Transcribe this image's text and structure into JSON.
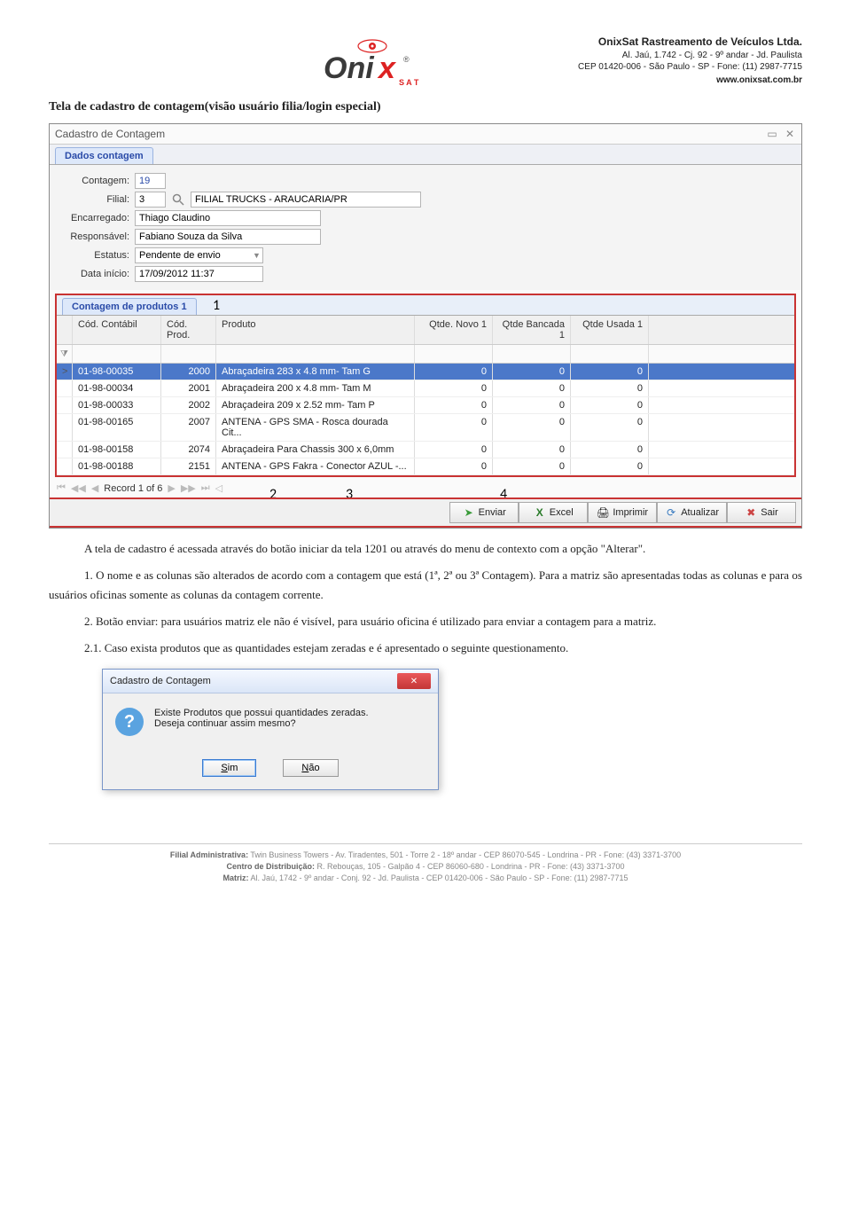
{
  "header": {
    "logo_text": "Onix",
    "logo_sub": "SAT",
    "reg": "®",
    "company_name": "OnixSat Rastreamento de Veículos Ltda.",
    "addr1": "Al. Jaú, 1.742 - Cj. 92 - 9º andar - Jd. Paulista",
    "addr2": "CEP 01420-006 - São Paulo - SP - Fone: (11) 2987-7715",
    "url": "www.onixsat.com.br"
  },
  "section_title": "Tela de cadastro de contagem(visão usuário filia/login especial)",
  "window": {
    "title": "Cadastro de Contagem",
    "tab": "Dados contagem",
    "form": {
      "contagem_label": "Contagem:",
      "contagem_value": "19",
      "filial_label": "Filial:",
      "filial_id": "3",
      "filial_name": "FILIAL TRUCKS - ARAUCARIA/PR",
      "encarregado_label": "Encarregado:",
      "encarregado_value": "Thiago Claudino",
      "responsavel_label": "Responsável:",
      "responsavel_value": "Fabiano Souza da Silva",
      "estatus_label": "Estatus:",
      "estatus_value": "Pendente de envio",
      "data_label": "Data início:",
      "data_value": "17/09/2012 11:37"
    },
    "grid": {
      "tab": "Contagem de produtos 1",
      "callout1": "1",
      "headers": {
        "cod_contabil": "Cód. Contábil",
        "cod_prod": "Cód. Prod.",
        "produto": "Produto",
        "qtde_novo": "Qtde. Novo 1",
        "qtde_bancada": "Qtde Bancada 1",
        "qtde_usada": "Qtde Usada 1"
      },
      "rows": [
        {
          "sel": ">",
          "cod": "01-98-00035",
          "prd": "2000",
          "desc": "Abraçadeira 283 x 4.8 mm- Tam G",
          "q1": "0",
          "q2": "0",
          "q3": "0",
          "selected": true
        },
        {
          "sel": "",
          "cod": "01-98-00034",
          "prd": "2001",
          "desc": "Abraçadeira 200 x 4.8 mm- Tam M",
          "q1": "0",
          "q2": "0",
          "q3": "0"
        },
        {
          "sel": "",
          "cod": "01-98-00033",
          "prd": "2002",
          "desc": "Abraçadeira 209 x 2.52 mm- Tam P",
          "q1": "0",
          "q2": "0",
          "q3": "0"
        },
        {
          "sel": "",
          "cod": "01-98-00165",
          "prd": "2007",
          "desc": "ANTENA - GPS SMA - Rosca dourada Cit...",
          "q1": "0",
          "q2": "0",
          "q3": "0"
        },
        {
          "sel": "",
          "cod": "01-98-00158",
          "prd": "2074",
          "desc": "Abraçadeira Para Chassis 300 x 6,0mm",
          "q1": "0",
          "q2": "0",
          "q3": "0"
        },
        {
          "sel": "",
          "cod": "01-98-00188",
          "prd": "2151",
          "desc": "ANTENA - GPS Fakra - Conector AZUL -...",
          "q1": "0",
          "q2": "0",
          "q3": "0"
        }
      ]
    },
    "pager": "Record 1 of 6",
    "toolbar": {
      "callout2": "2",
      "callout3": "3",
      "callout4": "4",
      "enviar": "Enviar",
      "excel": "Excel",
      "imprimir": "Imprimir",
      "atualizar": "Atualizar",
      "sair": "Sair"
    }
  },
  "body": {
    "p1": "A tela de cadastro é acessada através do botão iniciar da tela 1201 ou através do menu de contexto com a opção \"Alterar\".",
    "li1": "1. O nome e as colunas são alterados de acordo com a contagem que está (1ª, 2ª ou 3ª Contagem). Para a matriz são apresentadas todas as colunas e para os usuários oficinas somente as colunas da contagem corrente.",
    "li2": "2. Botão enviar: para usuários matriz ele não é visível, para usuário oficina é utilizado para enviar a contagem para a matriz.",
    "li21": "2.1. Caso exista produtos que as quantidades estejam zeradas e é apresentado o seguinte questionamento."
  },
  "dialog": {
    "title": "Cadastro de Contagem",
    "msg1": "Existe Produtos que possui quantidades zeradas.",
    "msg2": "Deseja continuar assim mesmo?",
    "sim": "Sim",
    "nao": "Não"
  },
  "footer": {
    "l1a": "Filial Administrativa:",
    "l1b": " Twin Business Towers - Av. Tiradentes, 501 - Torre 2 - 18º andar - CEP 86070-545 - Londrina - PR - Fone: (43) 3371-3700",
    "l2a": "Centro de Distribuição:",
    "l2b": " R. Rebouças, 105 - Galpão 4 - CEP 86060-680 - Londrina - PR - Fone: (43) 3371-3700",
    "l3a": "Matriz:",
    "l3b": " Al. Jaú, 1742 - 9º andar - Conj. 92 - Jd. Paulista - CEP 01420-006 - São Paulo - SP - Fone: (11) 2987-7715"
  }
}
